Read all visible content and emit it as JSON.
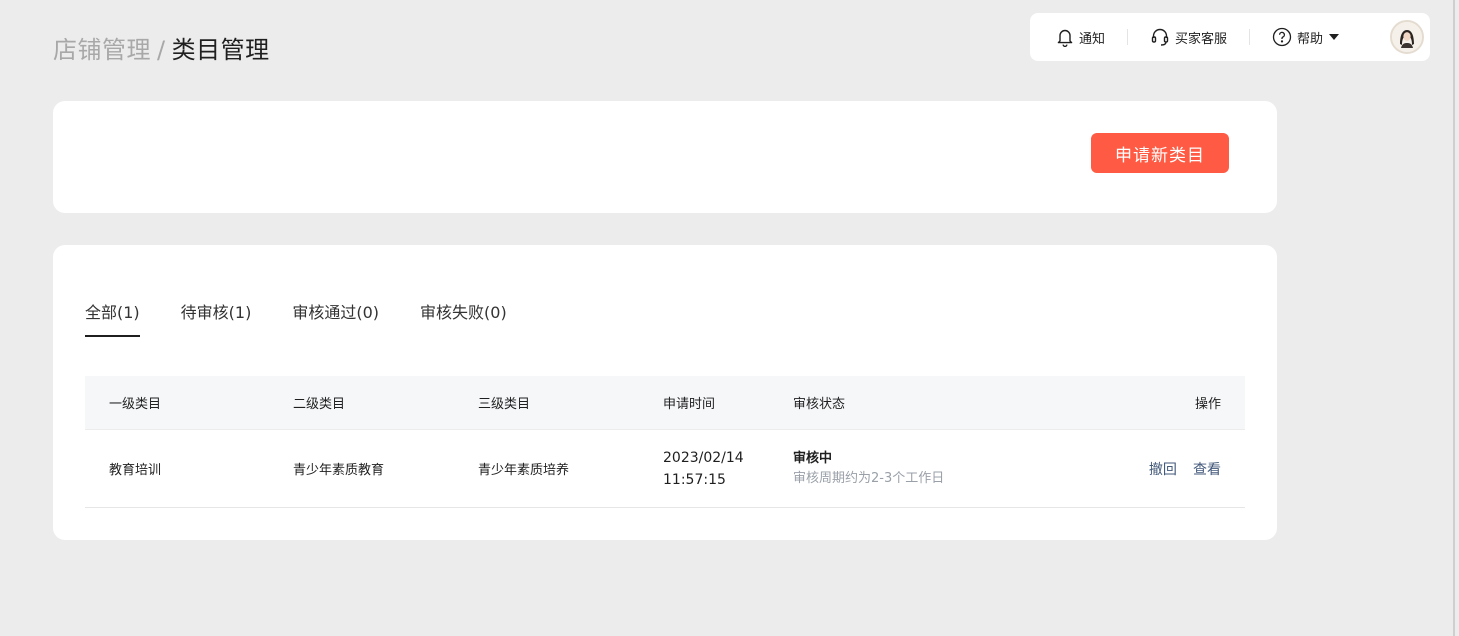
{
  "breadcrumb": {
    "parent": "店铺管理",
    "separator": "/",
    "current": "类目管理"
  },
  "topbar": {
    "notify_label": "通知",
    "service_label": "买家客服",
    "help_label": "帮助",
    "icons": [
      "bell-icon",
      "headset-icon",
      "help-circle-icon",
      "caret-down-icon",
      "avatar"
    ]
  },
  "actions": {
    "apply_label": "申请新类目"
  },
  "tabs": [
    {
      "label": "全部(1)",
      "active": true
    },
    {
      "label": "待审核(1)",
      "active": false
    },
    {
      "label": "审核通过(0)",
      "active": false
    },
    {
      "label": "审核失败(0)",
      "active": false
    }
  ],
  "table": {
    "headers": [
      "一级类目",
      "二级类目",
      "三级类目",
      "申请时间",
      "审核状态",
      "操作"
    ],
    "rows": [
      {
        "level1": "教育培训",
        "level2": "青少年素质教育",
        "level3": "青少年素质培养",
        "date": "2023/02/14",
        "time": "11:57:15",
        "status": "审核中",
        "status_note": "审核周期约为2-3个工作日",
        "action_revoke": "撤回",
        "action_view": "查看"
      }
    ]
  },
  "colors": {
    "accent": "#ff5a43",
    "link": "#42587a",
    "page_bg": "#ececec"
  }
}
